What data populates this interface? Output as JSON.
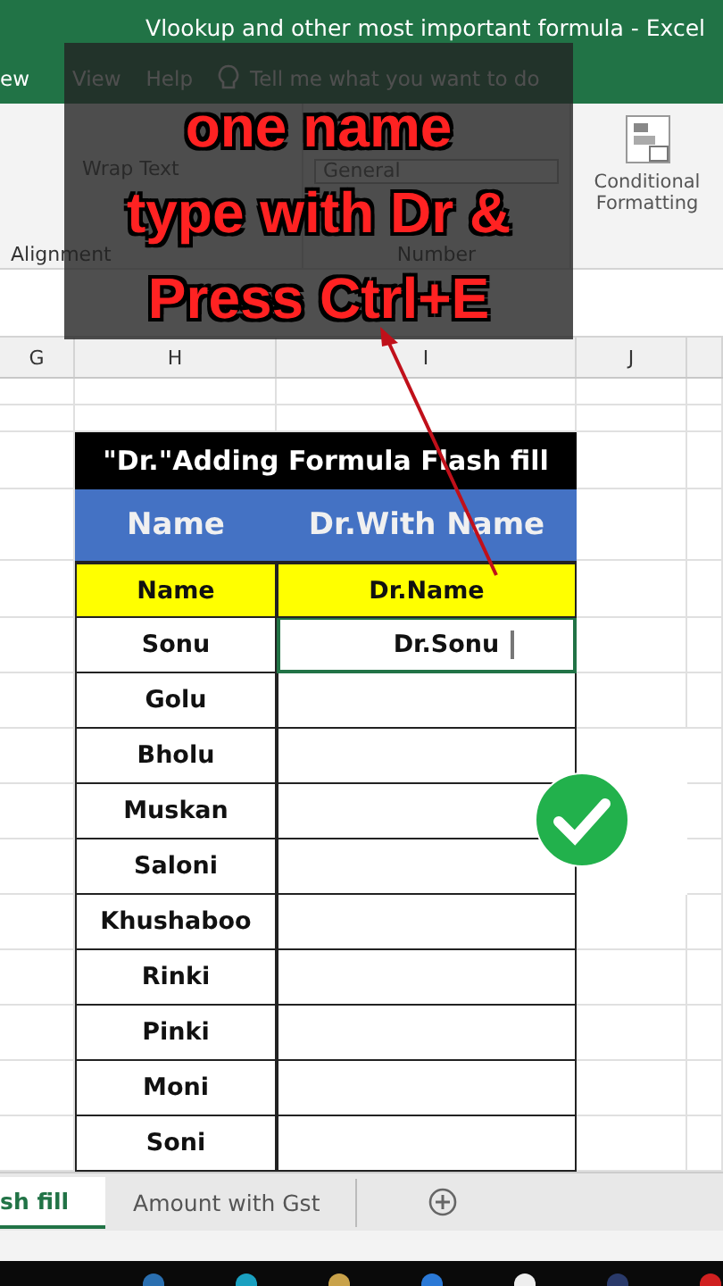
{
  "window": {
    "title": "Vlookup and other most important formula  -  Excel"
  },
  "menu": [
    {
      "label": "ew"
    },
    {
      "label": "View"
    },
    {
      "label": "Help"
    }
  ],
  "tell_me": {
    "placeholder": "Tell me what you want to do"
  },
  "ribbon": {
    "wrap_text": "Wrap Text",
    "number_format": "General",
    "groups": [
      "Alignment",
      "Number"
    ],
    "conditional_formatting": "Conditional Formatting"
  },
  "columns": [
    "G",
    "H",
    "I",
    "J"
  ],
  "table": {
    "title": "\"Dr.\"Adding Formula Flash fill",
    "headers": [
      "Name",
      "Dr.With Name"
    ],
    "subheaders": [
      "Name",
      "Dr.Name"
    ],
    "rows": [
      {
        "name": "Sonu",
        "dr_name": "Dr.Sonu",
        "editing": true
      },
      {
        "name": "Golu",
        "editing": false
      },
      {
        "name": "Bholu",
        "editing": false
      },
      {
        "name": "Muskan",
        "editing": false
      },
      {
        "name": "Saloni",
        "editing": false
      },
      {
        "name": "Khushaboo",
        "editing": false
      },
      {
        "name": "Rinki",
        "editing": false
      },
      {
        "name": "Pinki",
        "editing": false
      },
      {
        "name": "Moni",
        "editing": false
      },
      {
        "name": "Soni",
        "editing": false
      }
    ]
  },
  "overlay": {
    "lines": [
      "one name",
      "type with Dr &",
      "Press Ctrl+E"
    ]
  },
  "sheet_tabs": [
    {
      "label": "sh fill",
      "selected": true
    },
    {
      "label": "Amount with Gst",
      "selected": false
    }
  ]
}
